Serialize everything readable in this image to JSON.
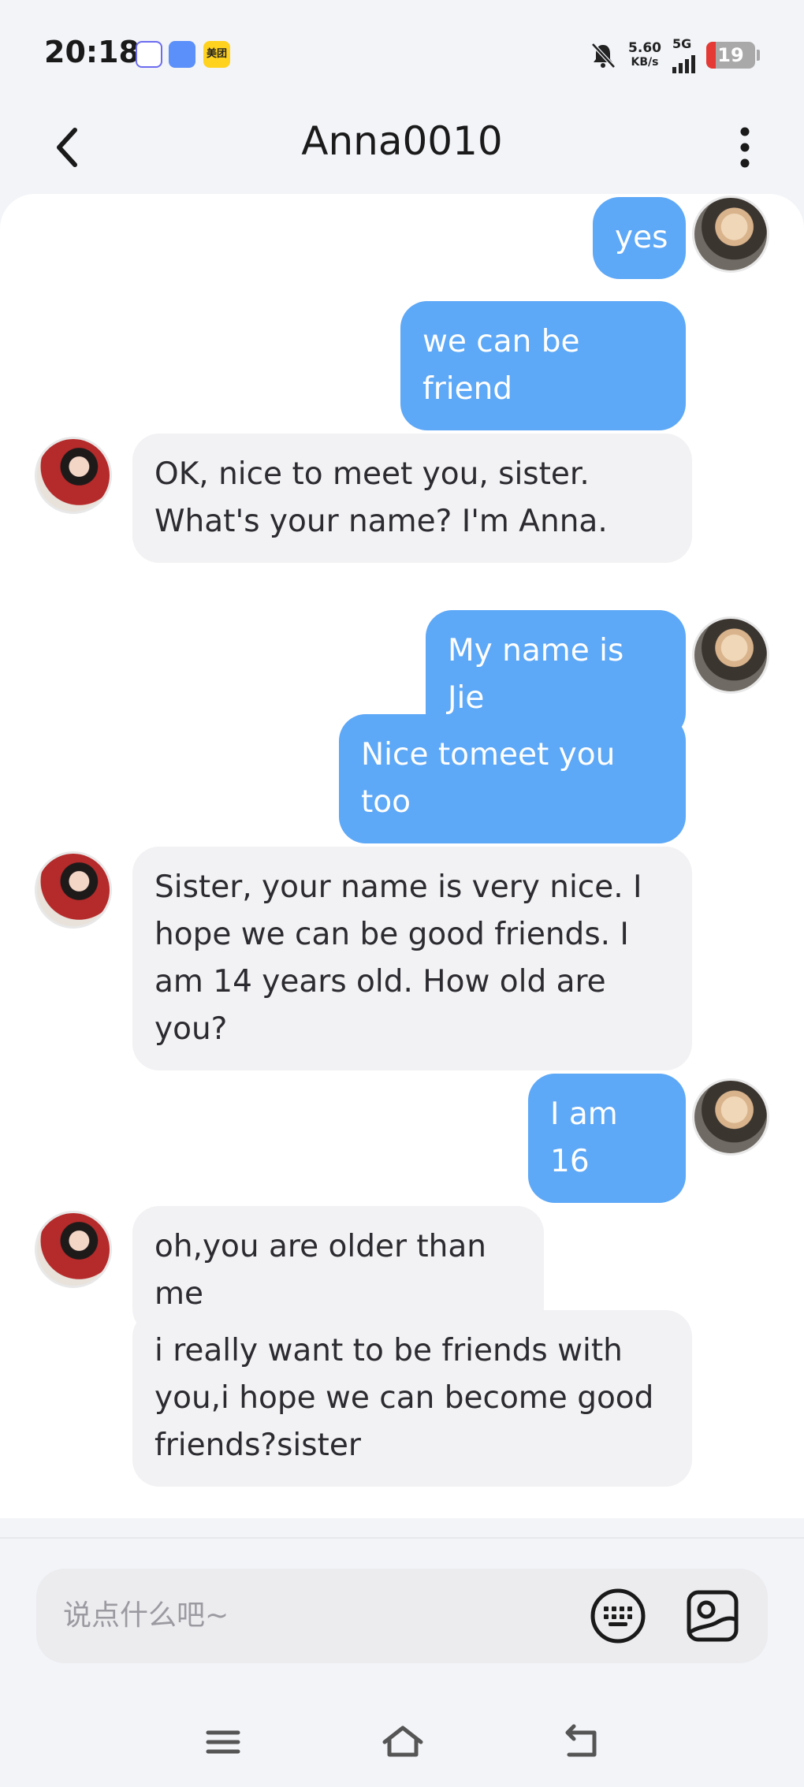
{
  "status_bar": {
    "time": "20:18",
    "net_speed_value": "5.60",
    "net_speed_unit": "KB/s",
    "network": "5G",
    "battery": "19",
    "battery_level": 0.19,
    "app_icons": [
      "tiktok-like-app-icon",
      "cloud-app-icon",
      "meituan-app-icon"
    ],
    "meituan_label": "美团"
  },
  "header": {
    "title": "Anna0010",
    "back_icon": "chevron-left-icon",
    "more_icon": "more-vertical-icon"
  },
  "messages": [
    {
      "from": "me",
      "text": "yes",
      "show_avatar": true
    },
    {
      "from": "me",
      "text": "we can be friend",
      "show_avatar": false
    },
    {
      "from": "anna",
      "text": "OK, nice to meet you, sister. What's your name? I'm Anna.",
      "show_avatar": true
    },
    {
      "from": "me",
      "text": "My name is Jie",
      "show_avatar": true
    },
    {
      "from": "me",
      "text": "Nice tomeet you too",
      "show_avatar": false
    },
    {
      "from": "anna",
      "text": "Sister, your name is very nice. I hope we can be good friends. I am 14 years old. How old are you?",
      "show_avatar": true
    },
    {
      "from": "me",
      "text": "I am  16",
      "show_avatar": true
    },
    {
      "from": "anna",
      "text": "oh,you are older than me",
      "show_avatar": true
    },
    {
      "from": "anna",
      "text": "i really want to be friends with you,i hope we can become good friends?sister",
      "show_avatar": false
    }
  ],
  "composer": {
    "placeholder": "说点什么吧~",
    "keyboard_icon": "keyboard-icon",
    "image_icon": "image-icon"
  },
  "nav": {
    "icons": [
      "menu-icon",
      "home-icon",
      "back-icon"
    ]
  },
  "colors": {
    "outgoing_bubble": "#5da8f7",
    "incoming_bubble": "#f2f2f4",
    "background": "#f2f4f8"
  }
}
